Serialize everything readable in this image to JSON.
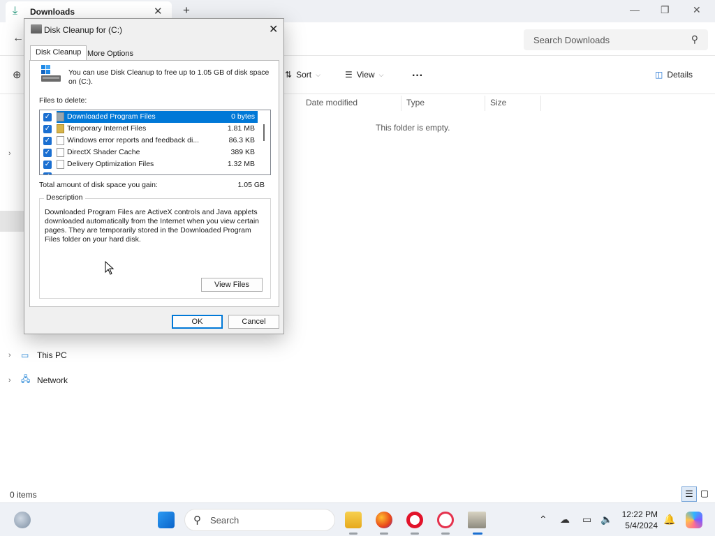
{
  "explorer": {
    "tab_title": "Downloads",
    "search_placeholder": "Search Downloads",
    "commands": {
      "sort": "Sort",
      "view": "View",
      "more": "···",
      "details": "Details"
    },
    "columns": [
      "Date modified",
      "Type",
      "Size"
    ],
    "empty_message": "This folder is empty.",
    "nav": {
      "this_pc": "This PC",
      "network": "Network"
    },
    "status": "0 items"
  },
  "dialog": {
    "title": "Disk Cleanup for  (C:)",
    "tabs": {
      "active": "Disk Cleanup",
      "inactive": "More Options"
    },
    "intro": "You can use Disk Cleanup to free up to 1.05 GB of disk space on  (C:).",
    "files_label": "Files to delete:",
    "files": [
      {
        "name": "Downloaded Program Files",
        "size": "0 bytes",
        "checked": true,
        "selected": true,
        "icon": "gray"
      },
      {
        "name": "Temporary Internet Files",
        "size": "1.81 MB",
        "checked": true,
        "selected": false,
        "icon": "lock"
      },
      {
        "name": "Windows error reports and feedback di...",
        "size": "86.3 KB",
        "checked": true,
        "selected": false,
        "icon": "file"
      },
      {
        "name": "DirectX Shader Cache",
        "size": "389 KB",
        "checked": true,
        "selected": false,
        "icon": "file"
      },
      {
        "name": "Delivery Optimization Files",
        "size": "1.32 MB",
        "checked": true,
        "selected": false,
        "icon": "file"
      }
    ],
    "total_label": "Total amount of disk space you gain:",
    "total_value": "1.05 GB",
    "description_legend": "Description",
    "description": "Downloaded Program Files are ActiveX controls and Java applets downloaded automatically from the Internet when you view certain pages. They are temporarily stored in the Downloaded Program Files folder on your hard disk.",
    "view_files": "View Files",
    "ok": "OK",
    "cancel": "Cancel"
  },
  "taskbar": {
    "search_label": "Search",
    "time": "12:22 PM",
    "date": "5/4/2024"
  }
}
